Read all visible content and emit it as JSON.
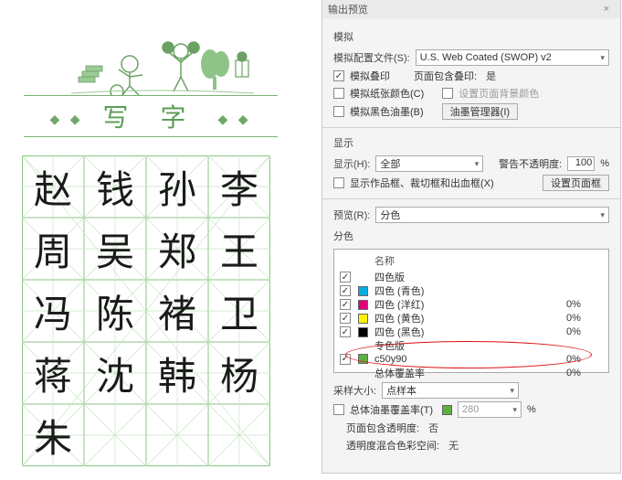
{
  "left": {
    "title": "写 字",
    "characters": [
      "赵",
      "钱",
      "孙",
      "李",
      "周",
      "吴",
      "郑",
      "王",
      "冯",
      "陈",
      "褚",
      "卫",
      "蒋",
      "沈",
      "韩",
      "杨",
      "朱"
    ]
  },
  "panel": {
    "title": "输出预览",
    "simulate": {
      "heading": "模拟",
      "profile_label": "模拟配置文件(S):",
      "profile_value": "U.S. Web Coated (SWOP) v2",
      "sim_overprint": "模拟叠印",
      "page_contains_overprint_label": "页面包含叠印:",
      "page_contains_overprint_value": "是",
      "sim_paper_color": "模拟纸张颜色(C)",
      "set_page_bg": "设置页面背景颜色",
      "sim_black_ink": "模拟黑色油墨(B)",
      "ink_manager_btn": "油墨管理器(I)"
    },
    "show": {
      "heading": "显示",
      "show_label": "显示(H):",
      "show_value": "全部",
      "opacity_warn_label": "警告不透明度:",
      "opacity_value": "100",
      "pct": "%",
      "show_trim_label": "显示作品框、裁切框和出血框(X)",
      "set_page_box_btn": "设置页面框"
    },
    "preview": {
      "label": "预览(R):",
      "value": "分色"
    },
    "separations": {
      "heading": "分色",
      "name_col": "名称",
      "process_label": "四色版",
      "spot_label": "专色版",
      "rows": [
        {
          "name": "四色 (青色)",
          "color": "#00aee6",
          "pct": ""
        },
        {
          "name": "四色 (洋红)",
          "color": "#e0007a",
          "pct": "0%"
        },
        {
          "name": "四色 (黄色)",
          "color": "#fff100",
          "pct": "0%"
        },
        {
          "name": "四色 (黑色)",
          "color": "#000000",
          "pct": "0%"
        }
      ],
      "spot": {
        "name": "c50y90",
        "color": "#5fae42",
        "pct": "0%"
      },
      "total_label": "总体覆盖率",
      "total_pct": "0%"
    },
    "bottom": {
      "sample_size_label": "采样大小:",
      "sample_size_value": "点样本",
      "total_ink_label": "总体油墨覆盖率(T)",
      "total_ink_value": "280",
      "pct": "%",
      "page_transparency_label": "页面包含透明度:",
      "page_transparency_value": "否",
      "blend_space_label": "透明度混合色彩空间:",
      "blend_space_value": "无"
    }
  }
}
